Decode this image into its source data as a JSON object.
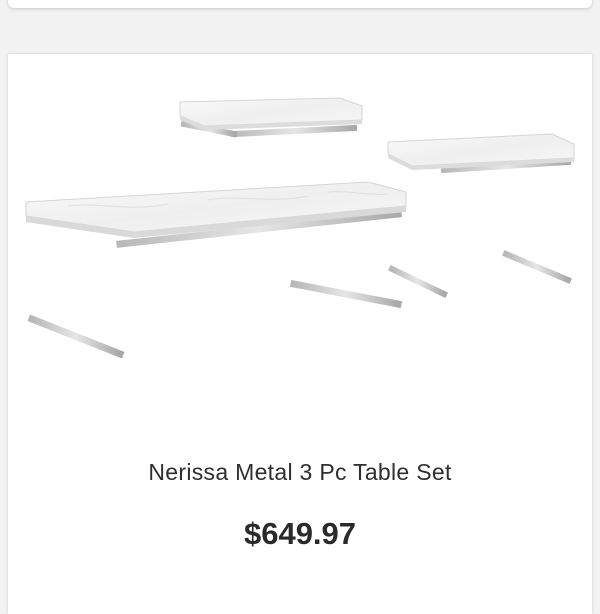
{
  "product": {
    "image_alt": "Nerissa Metal 3 Pc Table Set",
    "title": "Nerissa Metal 3 Pc Table Set",
    "price": "$649.97"
  },
  "colors": {
    "page_background": "#f2f2f2",
    "card_background": "#ffffff",
    "text": "#2f2f2f",
    "marble_top": "#f4f4f4",
    "chrome_frame": "#c9c9c9"
  }
}
